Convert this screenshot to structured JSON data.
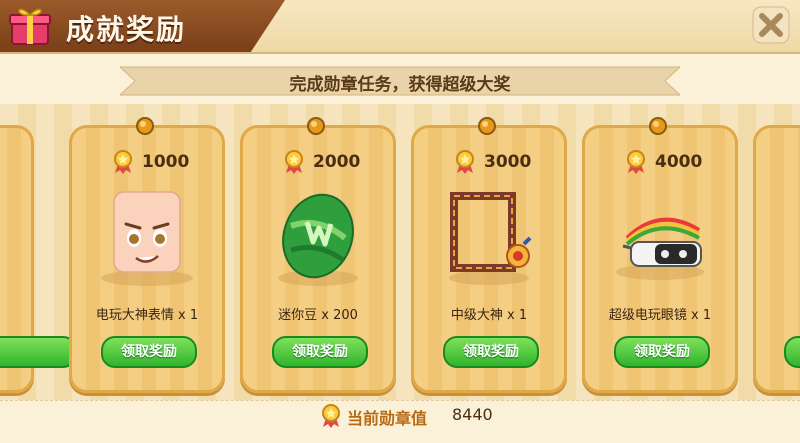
{
  "header": {
    "title": "成就奖励",
    "gift_icon": "gift-icon",
    "close_icon": "close-icon"
  },
  "subtitle": "完成勋章任务，获得超级大奖",
  "rewards": [
    {
      "cost": "1000",
      "name": "电玩大神表情 x 1",
      "button": "领取奖励",
      "icon": "face-expression-icon"
    },
    {
      "cost": "2000",
      "name": "迷你豆 x 200",
      "button": "领取奖励",
      "icon": "mini-bean-egg-icon"
    },
    {
      "cost": "3000",
      "name": "中级大神 x 1",
      "button": "领取奖励",
      "icon": "frame-medal-icon"
    },
    {
      "cost": "4000",
      "name": "超级电玩眼镜 x 1",
      "button": "领取奖励",
      "icon": "vr-goggles-icon"
    }
  ],
  "footer": {
    "label": "当前勋章值",
    "value": "8440"
  },
  "colors": {
    "accent_green": "#2fb52c",
    "title_brown": "#7a3f19",
    "card_gold": "#f4cf83"
  }
}
